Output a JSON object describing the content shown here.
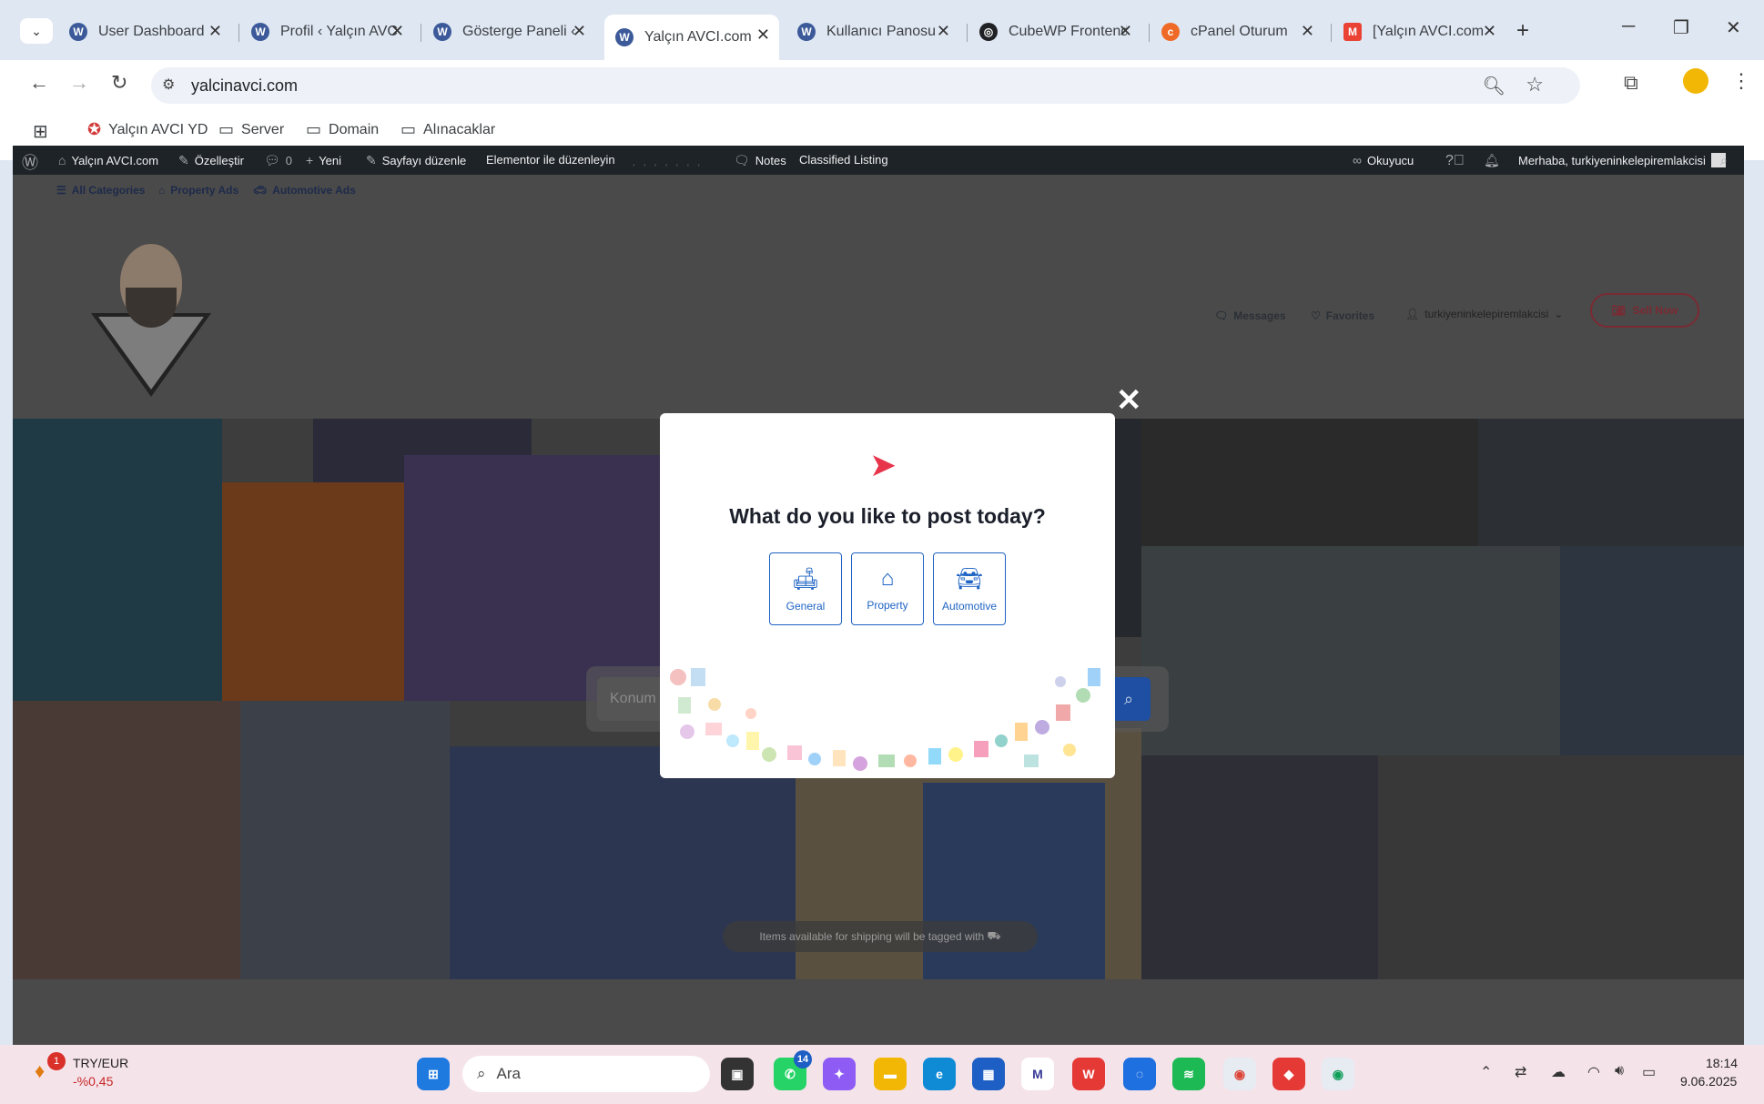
{
  "browser": {
    "tabs": [
      {
        "label": "User Dashboard",
        "favicon": "wordpress-icon"
      },
      {
        "label": "Profil ‹ Yalçın AVCI",
        "favicon": "wordpress-icon"
      },
      {
        "label": "Gösterge Paneli ‹",
        "favicon": "wordpress-icon"
      },
      {
        "label": "Yalçın AVCI.com",
        "favicon": "wordpress-icon"
      },
      {
        "label": "Kullanıcı Panosu",
        "favicon": "wordpress-icon"
      },
      {
        "label": "CubeWP Frontend",
        "favicon": "openai-icon"
      },
      {
        "label": "cPanel Oturum",
        "favicon": "cpanel-icon"
      },
      {
        "label": "[Yalçın AVCI.com",
        "favicon": "gmail-icon"
      }
    ],
    "url": "yalcinavci.com",
    "bookmarks": [
      {
        "label": "Yalçın AVCI YD",
        "icon": "site-icon"
      },
      {
        "label": "Server",
        "icon": "folder-icon"
      },
      {
        "label": "Domain",
        "icon": "folder-icon"
      },
      {
        "label": "Alınacaklar",
        "icon": "folder-icon"
      }
    ]
  },
  "adminbar": {
    "site": "Yalçın AVCI.com",
    "customize": "Özelleştir",
    "comments": "0",
    "new": "Yeni",
    "edit_page": "Sayfayı düzenle",
    "elementor": "Elementor ile düzenleyin",
    "notes": "Notes",
    "classified": "Classified Listing",
    "reader": "Okuyucu",
    "greeting": "Merhaba, turkiyeninkelepiremlakcisi"
  },
  "subnav": {
    "all_categories": "All Categories",
    "property_ads": "Property Ads",
    "automotive_ads": "Automotive Ads"
  },
  "header": {
    "messages": "Messages",
    "favorites": "Favorites",
    "user": "turkiyeninkelepiremlakcisi",
    "sell_now": "Sell Now"
  },
  "hero": {
    "search_placeholder": "Konum",
    "ship_note": "Items available for shipping will be tagged with"
  },
  "modal": {
    "title": "What do you like to post today?",
    "options": [
      {
        "label": "General",
        "icon": "sofa-icon"
      },
      {
        "label": "Property",
        "icon": "house-icon"
      },
      {
        "label": "Automotive",
        "icon": "car-icon"
      }
    ]
  },
  "taskbar": {
    "currency_pair": "TRY/EUR",
    "currency_change": "-%0,45",
    "currency_badge": "1",
    "search_label": "Ara",
    "whatsapp_badge": "14",
    "time": "18:14",
    "date": "9.06.2025"
  }
}
